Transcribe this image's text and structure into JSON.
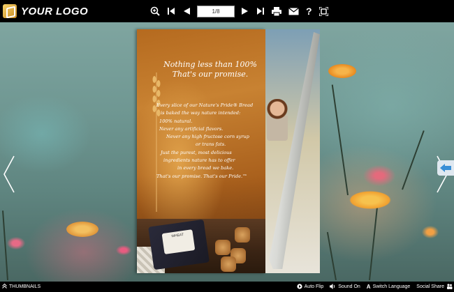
{
  "app": {
    "logo_text": "YOUR LOGO"
  },
  "toolbar": {
    "page_indicator": "1/8",
    "icons": [
      "zoom-in-icon",
      "first-page-icon",
      "previous-page-icon",
      "next-page-icon",
      "last-page-icon",
      "print-icon",
      "email-icon",
      "help-icon",
      "fullscreen-icon"
    ]
  },
  "book": {
    "headline": [
      "Nothing less than 100%",
      "That's our promise."
    ],
    "body_lines": [
      "Every slice of our Nature's Pride® Bread",
      "is baked the way nature intended:",
      "100% natural.",
      "Never any artificial flavors.",
      "Never any high fructose corn syrup",
      "or trans fats.",
      "Just the purest, most delicious",
      "ingredients nature has to offer",
      "in every bread we bake.",
      "That's our promise. That's our Pride.™"
    ],
    "bag_label": "WHEAT"
  },
  "bottombar": {
    "thumbnails": "THUMBNAILS",
    "auto_flip": "Auto Flip",
    "sound_on": "Sound On",
    "switch_language": "Switch Language",
    "social_share": "Social Share"
  },
  "colors": {
    "bar_bg": "#000000",
    "accent_blue": "#3a8fd6"
  }
}
